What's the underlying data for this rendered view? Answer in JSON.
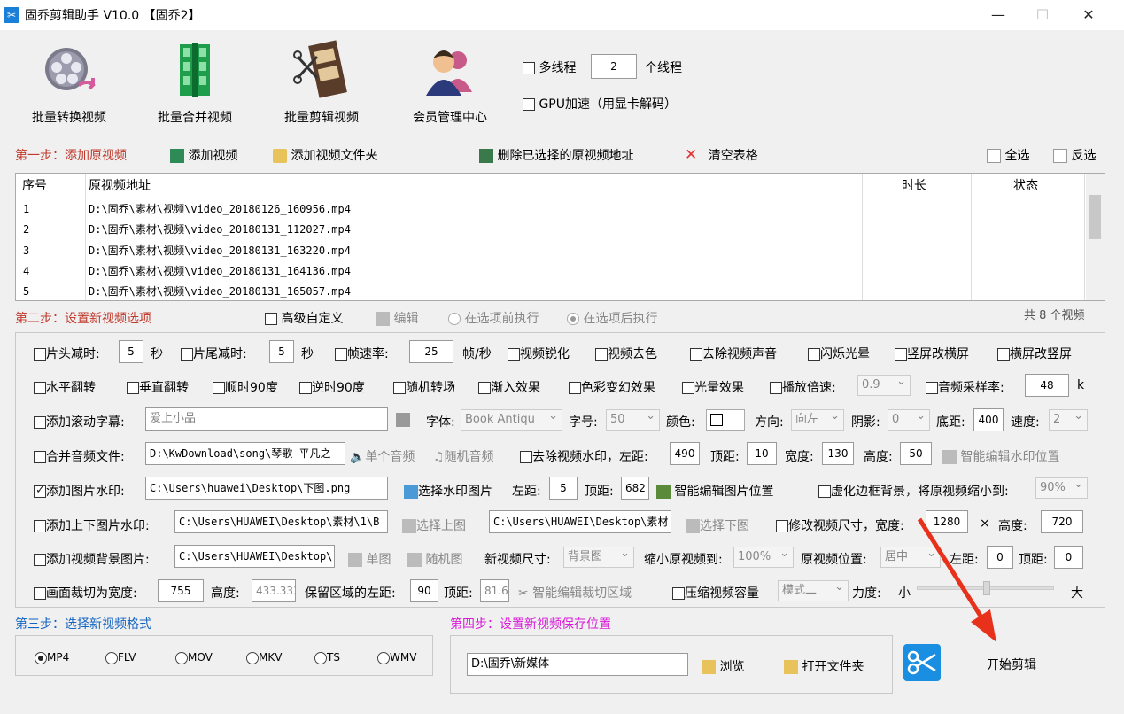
{
  "window": {
    "title": "固乔剪辑助手 V10.0 【固乔2】",
    "min": "—",
    "max": "☐",
    "close": "✕"
  },
  "toolbar": {
    "batch_convert": "批量转换视频",
    "batch_merge": "批量合并视频",
    "batch_edit": "批量剪辑视频",
    "member_center": "会员管理中心",
    "multithread_label": "多线程",
    "thread_count": "2",
    "thread_unit": "个线程",
    "gpu_label": "GPU加速（用显卡解码）"
  },
  "step1": {
    "title": "第一步：添加原视频",
    "add_video": "添加视频",
    "add_folder": "添加视频文件夹",
    "delete_selected": "删除已选择的原视频地址",
    "clear_table": "清空表格",
    "select_all": "全选",
    "invert": "反选"
  },
  "table": {
    "headers": {
      "index": "序号",
      "path": "原视频地址",
      "duration": "时长",
      "status": "状态"
    },
    "rows": [
      {
        "index": "1",
        "path": "D:\\固乔\\素材\\视频\\video_20180126_160956.mp4"
      },
      {
        "index": "2",
        "path": "D:\\固乔\\素材\\视频\\video_20180131_112027.mp4"
      },
      {
        "index": "3",
        "path": "D:\\固乔\\素材\\视频\\video_20180131_163220.mp4"
      },
      {
        "index": "4",
        "path": "D:\\固乔\\素材\\视频\\video_20180131_164136.mp4"
      },
      {
        "index": "5",
        "path": "D:\\固乔\\素材\\视频\\video_20180131_165057.mp4"
      }
    ],
    "total": "共 8 个视频"
  },
  "step2": {
    "title": "第二步：设置新视频选项",
    "advanced": "高级自定义",
    "edit": "编辑",
    "before": "在选项前执行",
    "after": "在选项后执行"
  },
  "opts": {
    "head_cut": "片头减时:",
    "head_val": "5",
    "sec1": "秒",
    "tail_cut": "片尾减时:",
    "tail_val": "5",
    "sec2": "秒",
    "fps": "帧速率:",
    "fps_val": "25",
    "fps_unit": "帧/秒",
    "sharpen": "视频锐化",
    "decolor": "视频去色",
    "remove_audio": "去除视频声音",
    "flash": "闪烁光晕",
    "v2h": "竖屏改横屏",
    "h2v": "横屏改竖屏",
    "hflip": "水平翻转",
    "vflip": "垂直翻转",
    "cw90": "顺时90度",
    "ccw90": "逆时90度",
    "random_trans": "随机转场",
    "fadein": "渐入效果",
    "color_fx": "色彩变幻效果",
    "light_fx": "光量效果",
    "speed": "播放倍速:",
    "speed_val": "0.9",
    "sample": "音频采样率:",
    "sample_val": "48",
    "sample_unit": "k",
    "scroll": "添加滚动字幕:",
    "scroll_text": "爱上小品",
    "font": "字体:",
    "font_val": "Book Antiqu",
    "fsize": "字号:",
    "fsize_val": "50",
    "color": "颜色:",
    "dir": "方向:",
    "dir_val": "向左",
    "shadow": "阴影:",
    "shadow_val": "0",
    "bottom": "底距:",
    "bottom_val": "400",
    "spd": "速度:",
    "spd_val": "2",
    "merge_audio": "合并音频文件:",
    "audio_path": "D:\\KwDownload\\song\\琴歌-平凡之",
    "single_audio": "单个音频",
    "random_audio": "随机音频",
    "rm_wm": "去除视频水印，左距:",
    "wm_left": "490",
    "wm_top_l": "顶距:",
    "wm_top": "10",
    "wm_w_l": "宽度:",
    "wm_w": "130",
    "wm_h_l": "高度:",
    "wm_h": "50",
    "smart_wm": "智能编辑水印位置",
    "img_wm": "添加图片水印:",
    "img_wm_path": "C:\\Users\\huawei\\Desktop\\下图.png",
    "choose_wm": "选择水印图片",
    "iw_left_l": "左距:",
    "iw_left": "5",
    "iw_top_l": "顶距:",
    "iw_top": "682",
    "smart_img": "智能编辑图片位置",
    "blur_bg": "虚化边框背景，将原视频缩小到:",
    "blur_val": "90%",
    "tb_wm": "添加上下图片水印:",
    "top_img_path": "C:\\Users\\HUAWEI\\Desktop\\素材\\1\\B",
    "choose_top": "选择上图",
    "bottom_img_path": "C:\\Users\\HUAWEI\\Desktop\\素材",
    "choose_bottom": "选择下图",
    "resize": "修改视频尺寸，宽度:",
    "rw": "1280",
    "x": "×",
    "rh_l": "高度:",
    "rh": "720",
    "bg_img": "添加视频背景图片:",
    "bg_path": "C:\\Users\\HUAWEI\\Desktop\\",
    "single_img": "单图",
    "random_img": "随机图",
    "new_size": "新视频尺寸:",
    "new_size_val": "背景图",
    "shrink": "缩小原视频到:",
    "shrink_val": "100%",
    "pos": "原视频位置:",
    "pos_val": "居中",
    "pos_left_l": "左距:",
    "pos_left": "0",
    "pos_top_l": "顶距:",
    "pos_top": "0",
    "crop": "画面裁切为宽度:",
    "crop_w": "755",
    "crop_h_l": "高度:",
    "crop_h": "433.333",
    "keep": "保留区域的左距:",
    "keep_l": "90",
    "keep_t_l": "顶距:",
    "keep_t": "81.6",
    "smart_crop": "智能编辑裁切区域",
    "compress": "压缩视频容量",
    "mode": "模式二",
    "strength": "力度:",
    "small": "小",
    "big": "大"
  },
  "step3": {
    "title": "第三步：选择新视频格式",
    "formats": [
      "MP4",
      "FLV",
      "MOV",
      "MKV",
      "TS",
      "WMV"
    ]
  },
  "step4": {
    "title": "第四步：设置新视频保存位置",
    "path": "D:\\固乔\\新媒体",
    "browse": "浏览",
    "open_folder": "打开文件夹"
  },
  "start": "开始剪辑",
  "colors": {
    "step_title": "#c0392b",
    "step3": "#1565c0",
    "step4": "#d81bd8",
    "arrow": "#e8311b"
  }
}
